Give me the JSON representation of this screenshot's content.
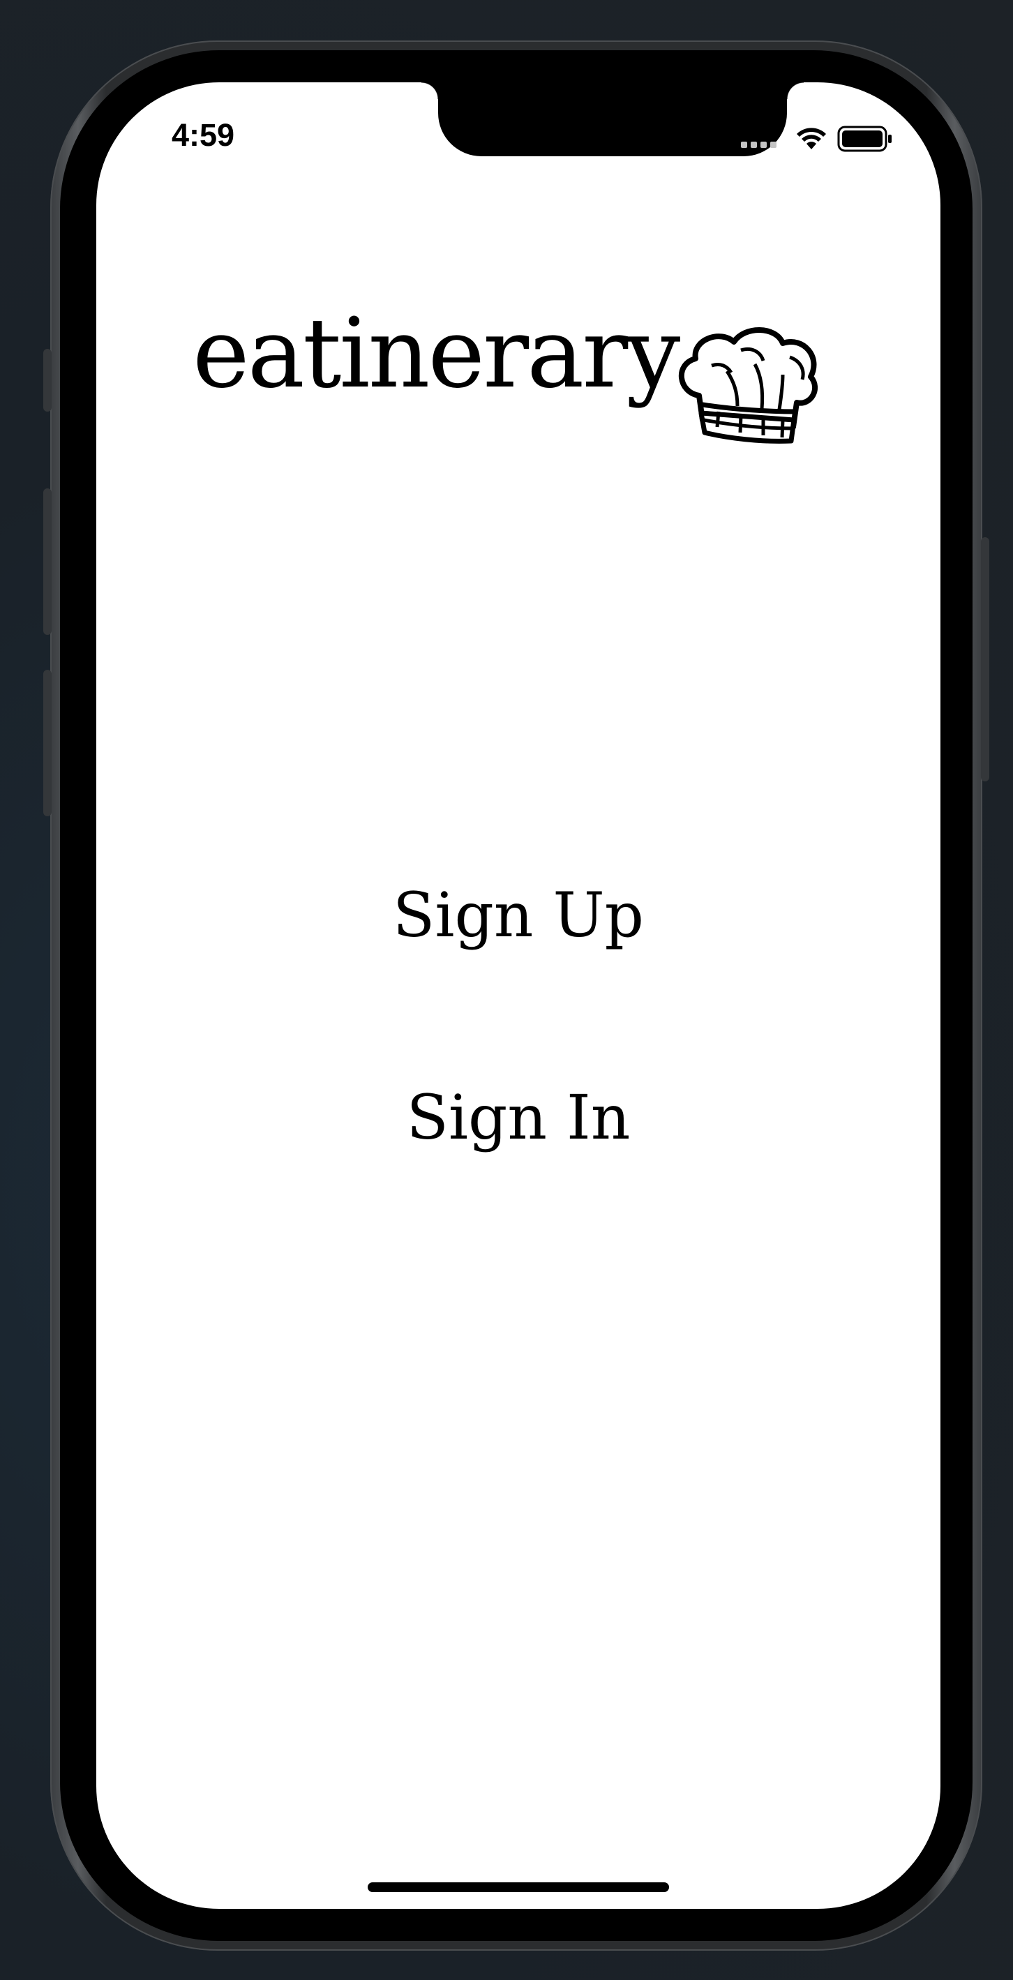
{
  "status_bar": {
    "time": "4:59",
    "icons": [
      "cellular-signal-icon",
      "wifi-icon",
      "battery-icon"
    ]
  },
  "app": {
    "logo_text": "eatinerary",
    "logo_icon": "chef-hat-icon"
  },
  "actions": {
    "sign_up_label": "Sign Up",
    "sign_in_label": "Sign In"
  },
  "colors": {
    "screen_background": "#ffffff",
    "text": "#000000",
    "device_frame": "#000000"
  }
}
